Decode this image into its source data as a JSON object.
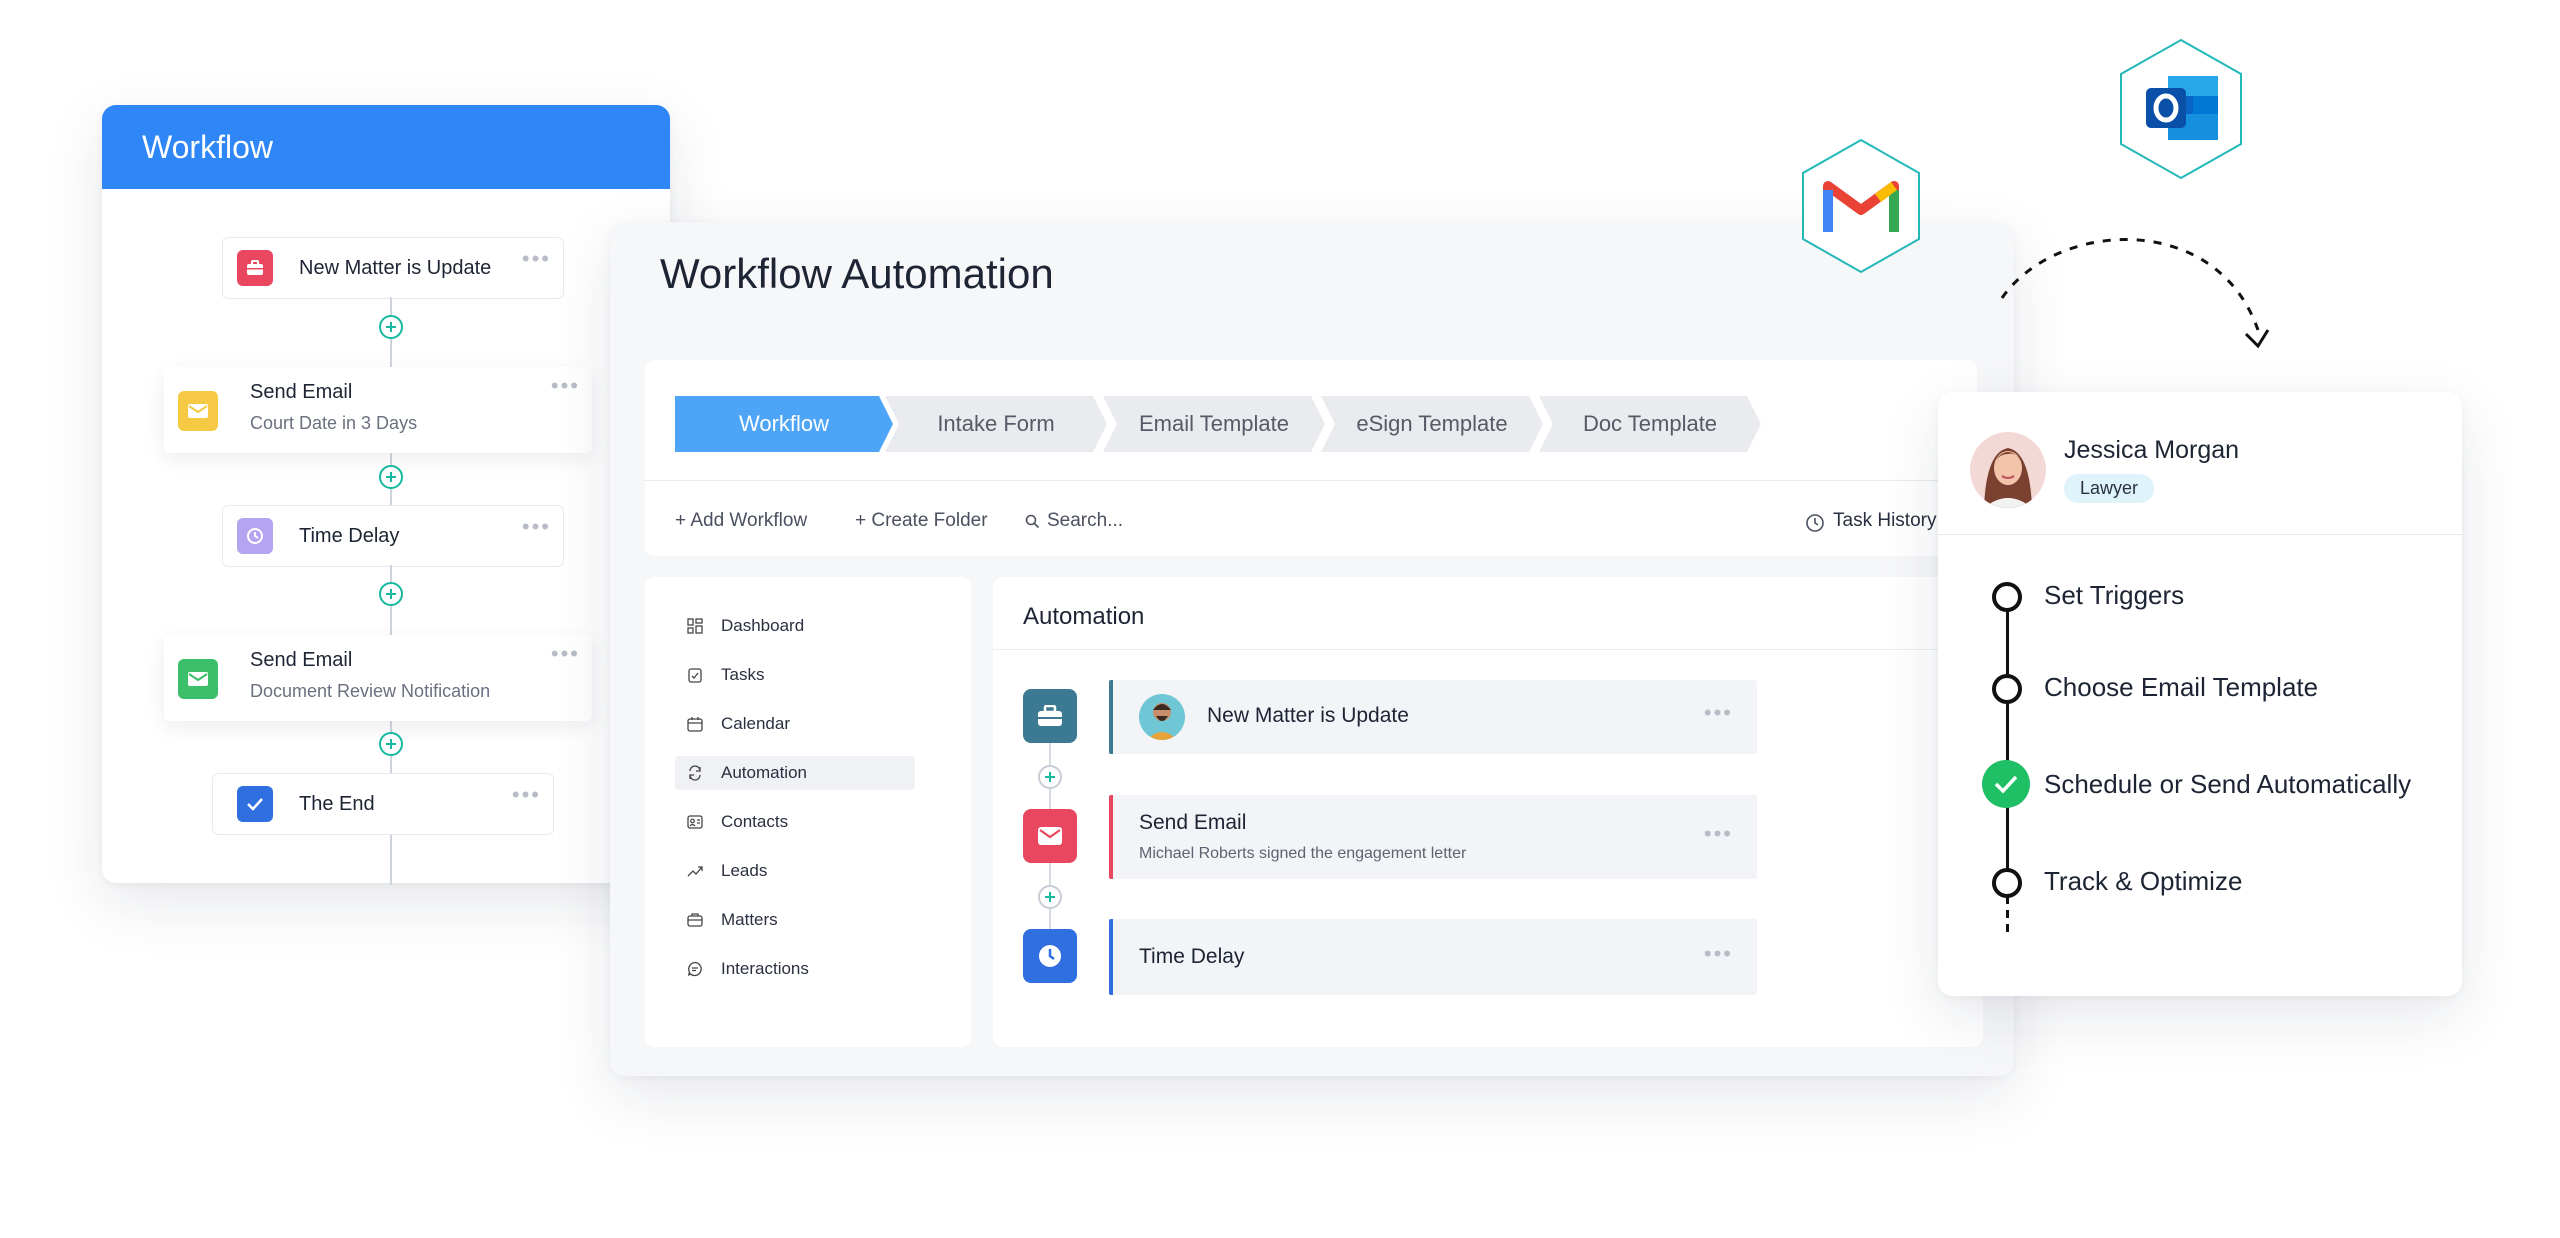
{
  "workflow_panel": {
    "title": "Workflow",
    "nodes": [
      {
        "title": "New Matter is Update",
        "subtitle": ""
      },
      {
        "title": "Send Email",
        "subtitle": "Court Date in 3 Days"
      },
      {
        "title": "Time Delay",
        "subtitle": ""
      },
      {
        "title": "Send Email",
        "subtitle": "Document Review Notification"
      },
      {
        "title": "The End",
        "subtitle": ""
      }
    ],
    "menu_glyph": "•••"
  },
  "main": {
    "title": "Workflow Automation",
    "tabs": [
      "Workflow",
      "Intake Form",
      "Email Template",
      "eSign Template",
      "Doc Template"
    ],
    "active_tab": "Workflow",
    "toolbar": {
      "add_workflow": "+ Add Workflow",
      "create_folder": "+ Create Folder",
      "search_placeholder": "Search...",
      "task_history": "Task History"
    },
    "sidebar": [
      {
        "label": "Dashboard",
        "icon": "dashboard-icon"
      },
      {
        "label": "Tasks",
        "icon": "clipboard-icon"
      },
      {
        "label": "Calendar",
        "icon": "calendar-icon"
      },
      {
        "label": "Automation",
        "icon": "refresh-icon",
        "active": true
      },
      {
        "label": "Contacts",
        "icon": "contact-card-icon"
      },
      {
        "label": "Leads",
        "icon": "trend-up-icon"
      },
      {
        "label": "Matters",
        "icon": "briefcase-icon"
      },
      {
        "label": "Interactions",
        "icon": "chat-icon"
      }
    ],
    "automation": {
      "title": "Automation",
      "items": [
        {
          "title": "New Matter is Update",
          "subtitle": ""
        },
        {
          "title": "Send Email",
          "subtitle": "Michael Roberts signed the engagement letter"
        },
        {
          "title": "Time Delay",
          "subtitle": ""
        }
      ]
    }
  },
  "person": {
    "name": "Jessica Morgan",
    "role": "Lawyer",
    "steps": [
      {
        "label": "Set Triggers",
        "done": false
      },
      {
        "label": "Choose Email Template",
        "done": false
      },
      {
        "label": "Schedule or Send Automatically",
        "done": true
      },
      {
        "label": "Track & Optimize",
        "done": false
      }
    ]
  },
  "integrations": [
    "gmail-logo",
    "outlook-logo"
  ],
  "colors": {
    "primary": "#2f86f6",
    "tab_active": "#4ea5f8",
    "teal": "#16b8a0",
    "red": "#e8475f",
    "yellow": "#f6c945",
    "purple": "#b5a4f0",
    "green": "#3bbf6a",
    "blue_check": "#2f6fe0",
    "dark_teal": "#3c7a93",
    "clock_blue": "#2f6fe0",
    "success": "#1fbf66"
  }
}
